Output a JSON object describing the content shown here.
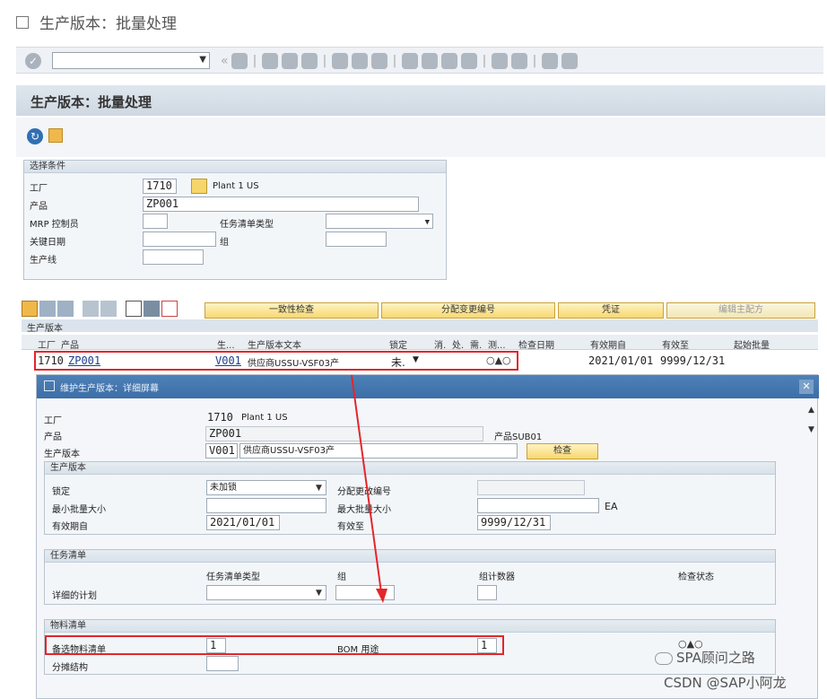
{
  "window": {
    "title": "生产版本：批量处理"
  },
  "page": {
    "header": "生产版本：批量处理"
  },
  "selection": {
    "group_title": "选择条件",
    "plant_label": "工厂",
    "plant_value": "1710",
    "plant_desc": "Plant 1 US",
    "product_label": "产品",
    "product_value": "ZP001",
    "mrp_label": "MRP 控制员",
    "tasklist_type_label": "任务清单类型",
    "keydate_label": "关键日期",
    "group_label": "组",
    "prodline_label": "生产线"
  },
  "grid_toolbar": {
    "consistency": "一致性检查",
    "assign_change": "分配变更编号",
    "voucher": "凭证",
    "edit_formula": "编辑主配方"
  },
  "grid": {
    "title": "生产版本",
    "columns": [
      "工厂",
      "产品",
      "生...",
      "生产版本文本",
      "锁定",
      "消.",
      "处.",
      "需.",
      "测...",
      "检查日期",
      "有效期自",
      "有效至",
      "起始批量"
    ],
    "row": {
      "plant": "1710",
      "product": "ZP001",
      "version": "V001",
      "text": "供应商USSU-VSF03产",
      "lock": "未.",
      "valid_from": "2021/01/01",
      "valid_to": "9999/12/31"
    }
  },
  "dialog": {
    "title": "维护生产版本：详细屏幕",
    "plant_label": "工厂",
    "plant_value": "1710",
    "plant_desc": "Plant 1 US",
    "product_label": "产品",
    "product_value": "ZP001",
    "product_desc": "产品SUB01",
    "version_label": "生产版本",
    "version_value": "V001",
    "version_text": "供应商USSU-VSF03产",
    "check_button": "检查",
    "pv_group": {
      "title": "生产版本",
      "lock_label": "锁定",
      "lock_value": "未加锁",
      "assign_label": "分配更改编号",
      "min_label": "最小批量大小",
      "max_label": "最大批量大小",
      "unit": "EA",
      "from_label": "有效期自",
      "from_value": "2021/01/01",
      "to_label": "有效至",
      "to_value": "9999/12/31"
    },
    "tl_group": {
      "title": "任务清单",
      "type_header": "任务清单类型",
      "group_header": "组",
      "counter_header": "组计数器",
      "status_header": "检查状态",
      "detail_label": "详细的计划"
    },
    "bom_group": {
      "title": "物料清单",
      "alt_label": "备选物料清单",
      "alt_value": "1",
      "usage_label": "BOM 用途",
      "usage_value": "1",
      "split_label": "分摊结构"
    }
  },
  "watermark": {
    "line1": "SPA顾问之路",
    "line2": "CSDN @SAP小阿龙"
  },
  "colors": {
    "annotation_red": "#e3262b",
    "dialog_header": "#4f81b8"
  }
}
